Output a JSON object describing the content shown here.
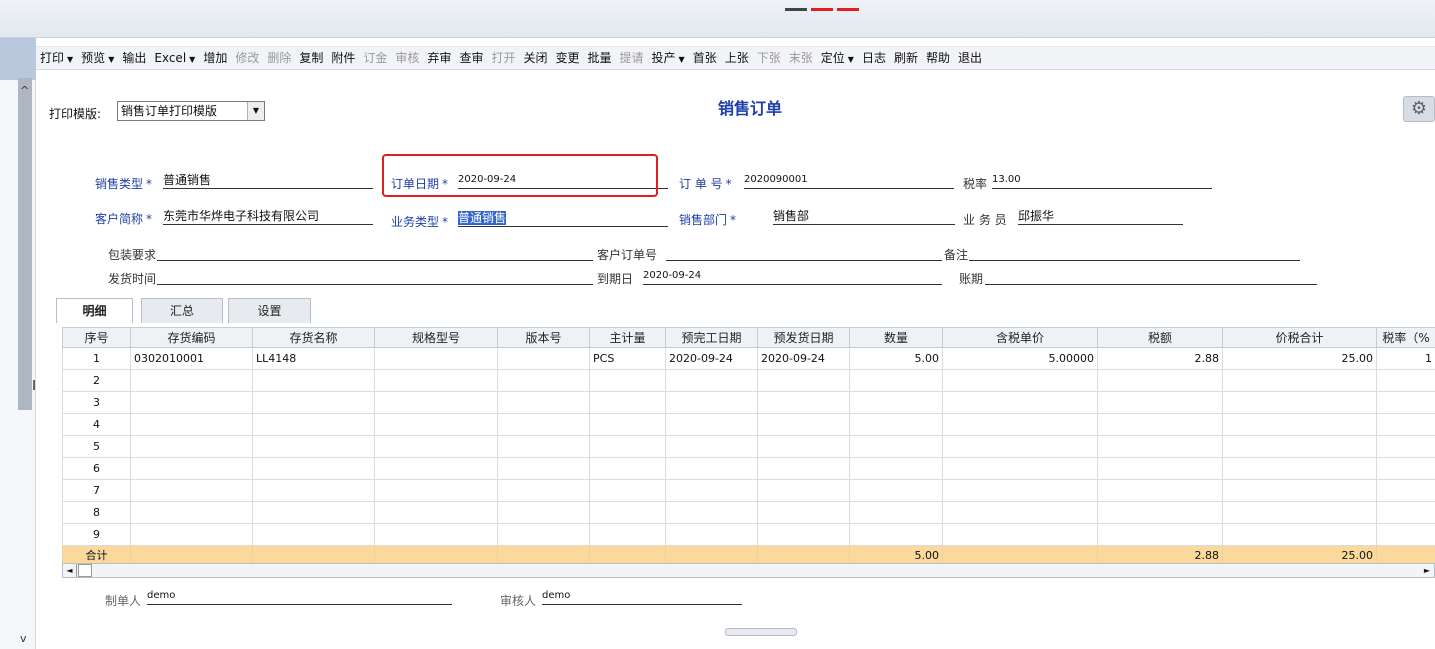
{
  "toolbar": [
    {
      "label": "打印",
      "dropdown": true,
      "enabled": true
    },
    {
      "label": "预览",
      "dropdown": true,
      "enabled": true
    },
    {
      "label": "输出",
      "dropdown": false,
      "enabled": true
    },
    {
      "label": "Excel",
      "dropdown": true,
      "enabled": true
    },
    {
      "label": "增加",
      "dropdown": false,
      "enabled": true
    },
    {
      "label": "修改",
      "dropdown": false,
      "enabled": false
    },
    {
      "label": "删除",
      "dropdown": false,
      "enabled": false
    },
    {
      "label": "复制",
      "dropdown": false,
      "enabled": true
    },
    {
      "label": "附件",
      "dropdown": false,
      "enabled": true
    },
    {
      "label": "订金",
      "dropdown": false,
      "enabled": false
    },
    {
      "label": "审核",
      "dropdown": false,
      "enabled": false
    },
    {
      "label": "弃审",
      "dropdown": false,
      "enabled": true
    },
    {
      "label": "查审",
      "dropdown": false,
      "enabled": true
    },
    {
      "label": "打开",
      "dropdown": false,
      "enabled": false
    },
    {
      "label": "关闭",
      "dropdown": false,
      "enabled": true
    },
    {
      "label": "变更",
      "dropdown": false,
      "enabled": true
    },
    {
      "label": "批量",
      "dropdown": false,
      "enabled": true
    },
    {
      "label": "提请",
      "dropdown": false,
      "enabled": false
    },
    {
      "label": "投产",
      "dropdown": true,
      "enabled": true
    },
    {
      "label": "首张",
      "dropdown": false,
      "enabled": true
    },
    {
      "label": "上张",
      "dropdown": false,
      "enabled": true
    },
    {
      "label": "下张",
      "dropdown": false,
      "enabled": false
    },
    {
      "label": "末张",
      "dropdown": false,
      "enabled": false
    },
    {
      "label": "定位",
      "dropdown": true,
      "enabled": true
    },
    {
      "label": "日志",
      "dropdown": false,
      "enabled": true
    },
    {
      "label": "刷新",
      "dropdown": false,
      "enabled": true
    },
    {
      "label": "帮助",
      "dropdown": false,
      "enabled": true
    },
    {
      "label": "退出",
      "dropdown": false,
      "enabled": true
    }
  ],
  "icons": {
    "dropdown": "▼",
    "settings": "⚙",
    "scroll_up": "^",
    "scroll_down": "v",
    "scroll_left": "◄",
    "scroll_right": "►"
  },
  "template": {
    "label": "打印模版:",
    "value": "销售订单打印模版"
  },
  "title": "销售订单",
  "header": {
    "sales_type": {
      "label": "销售类型",
      "value": "普通销售"
    },
    "order_date": {
      "label": "订单日期",
      "value": "2020-09-24"
    },
    "order_no": {
      "label": "订 单 号",
      "value": "2020090001"
    },
    "tax_rate": {
      "label": "税率",
      "value": "13.00"
    },
    "customer": {
      "label": "客户简称",
      "value": "东莞市华烨电子科技有限公司"
    },
    "biz_type": {
      "label": "业务类型",
      "value": "普通销售"
    },
    "sales_dept": {
      "label": "销售部门",
      "value": "销售部"
    },
    "salesman": {
      "label": "业 务 员",
      "value": "邱振华"
    },
    "packaging": {
      "label": "包装要求",
      "value": ""
    },
    "customer_po": {
      "label": "客户订单号",
      "value": ""
    },
    "remark": {
      "label": "备注",
      "value": ""
    },
    "ship_time": {
      "label": "发货时间",
      "value": ""
    },
    "due_date": {
      "label": "到期日",
      "value": "2020-09-24"
    },
    "account_period": {
      "label": "账期",
      "value": ""
    },
    "required_mark": "*"
  },
  "tabs": [
    "明细",
    "汇总",
    "设置"
  ],
  "grid": {
    "columns": [
      "序号",
      "存货编码",
      "存货名称",
      "规格型号",
      "版本号",
      "主计量",
      "预完工日期",
      "预发货日期",
      "数量",
      "含税单价",
      "税额",
      "价税合计",
      "税率（%"
    ],
    "rows": [
      {
        "no": "1",
        "code": "0302010001",
        "name": "LL4148",
        "spec": "",
        "version": "",
        "unit": "PCS",
        "finish_date": "2020-09-24",
        "ship_date": "2020-09-24",
        "qty": "5.00",
        "price": "5.00000",
        "tax": "2.88",
        "total": "25.00",
        "tax_rate": "1"
      },
      {
        "no": "2"
      },
      {
        "no": "3"
      },
      {
        "no": "4"
      },
      {
        "no": "5"
      },
      {
        "no": "6"
      },
      {
        "no": "7"
      },
      {
        "no": "8"
      },
      {
        "no": "9"
      }
    ],
    "total_row": {
      "label": "合计",
      "qty": "5.00",
      "tax": "2.88",
      "total": "25.00"
    }
  },
  "footer": {
    "maker": {
      "label": "制单人",
      "value": "demo"
    },
    "auditor": {
      "label": "审核人",
      "value": "demo"
    }
  },
  "colors": {
    "title_blue": "#1f3fa8",
    "highlight_red": "#e02020",
    "total_row_bg": "#fbd99c",
    "selection_blue": "#3366cc"
  }
}
